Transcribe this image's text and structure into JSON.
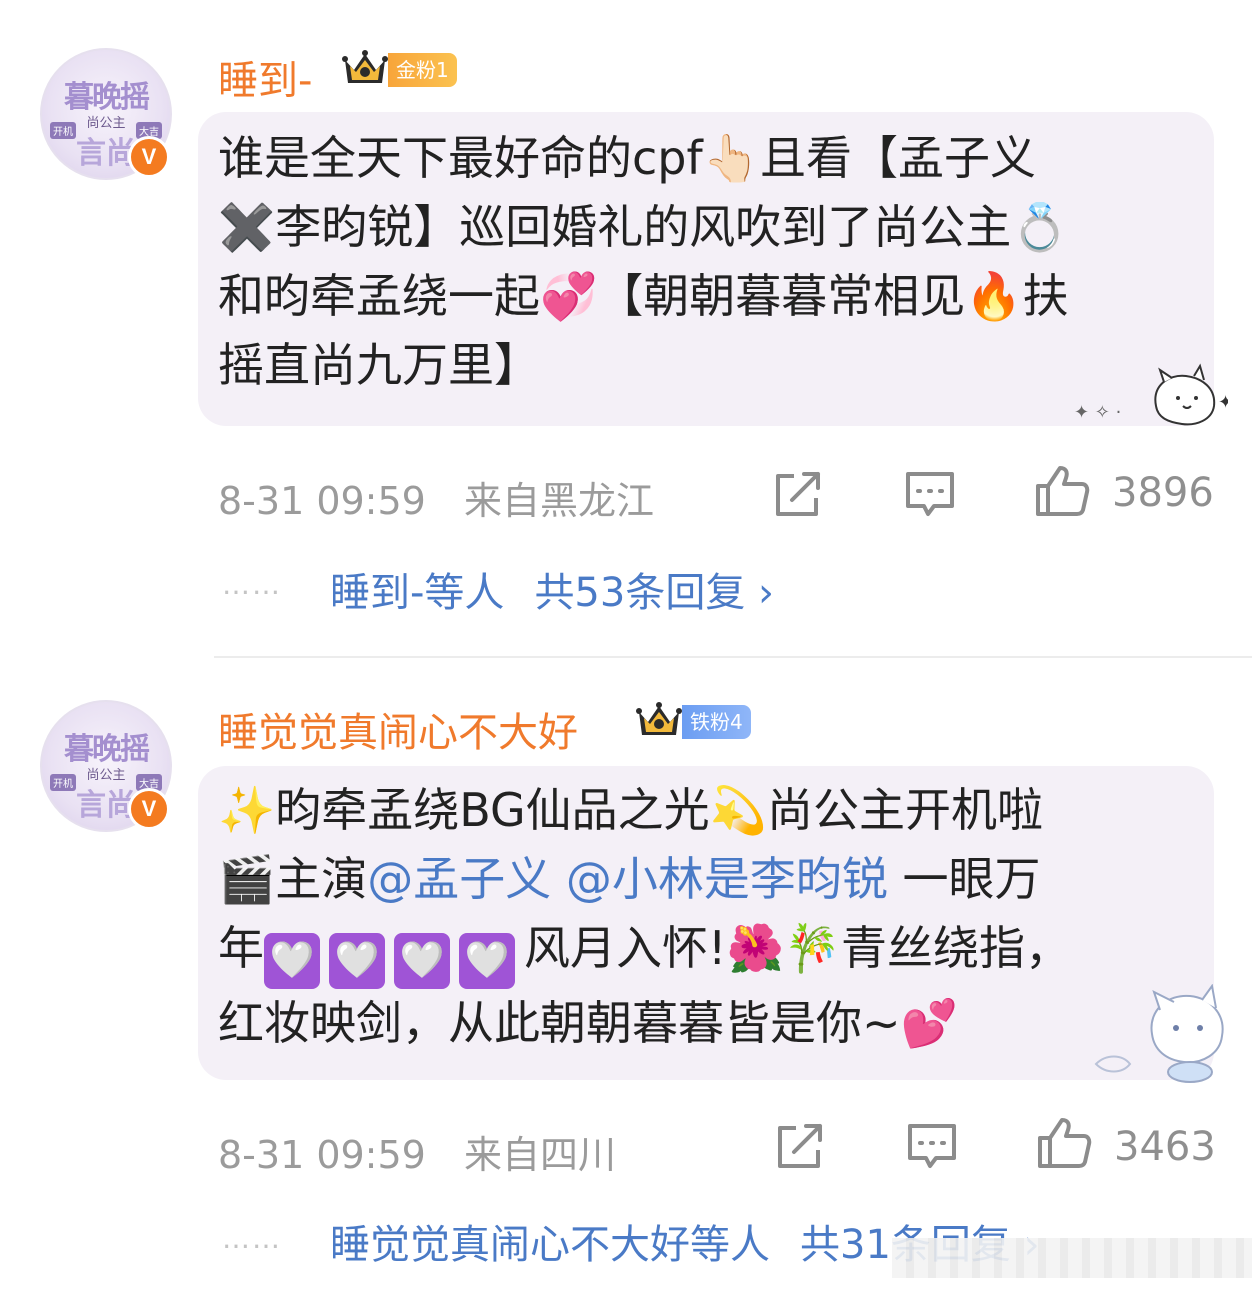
{
  "comments": [
    {
      "username": "睡到-",
      "fan_badge": "金粉1",
      "lines": [
        "谁是全天下最好命的cpf👆🏻且看【孟子义",
        "✖️李昀锐】巡回婚礼的风吹到了尚公主💍",
        "和昀牵孟绕一起💞【朝朝暮暮常相见🔥扶",
        "摇直尚九万里】"
      ],
      "date": "8-31 09:59",
      "location": "来自黑龙江",
      "likes": "3896",
      "replies_by": "睡到-等人",
      "replies_count": "共53条回复 ›"
    },
    {
      "username": "睡觉觉真闹心不大好",
      "fan_badge": "铁粉4",
      "lines": [
        "✨昀牵孟绕BG仙品之光💫尚公主开机啦",
        "🎬主演",
        "@孟子义 @小林是李昀锐",
        " 一眼万",
        "年",
        "风月入怀!🌺🎋青丝绕指，",
        "红妆映剑，从此朝朝暮暮皆是你~💕"
      ],
      "hearts": [
        "🤍",
        "🤍",
        "🤍",
        "🤍"
      ],
      "date": "8-31 09:59",
      "location": "来自四川",
      "likes": "3463",
      "replies_by": "睡觉觉真闹心不大好等人",
      "replies_count": "共31条回复 ›"
    }
  ],
  "avatar": {
    "line1": "暮晚摇",
    "line2": "尚公主",
    "line3": "言尚",
    "tag_left": "开机",
    "tag_right": "大吉"
  },
  "verified_mark": "V",
  "more_dots": "……",
  "icons": [
    "share-icon",
    "comment-icon",
    "like-icon",
    "crown-icon"
  ],
  "colors": {
    "username": "#f07a2c",
    "link": "#4a7ac6",
    "bubble": "#f4f0f7",
    "gold_badge": "#f8a53a",
    "iron_badge": "#6b9df2",
    "verified": "#f47b20"
  }
}
